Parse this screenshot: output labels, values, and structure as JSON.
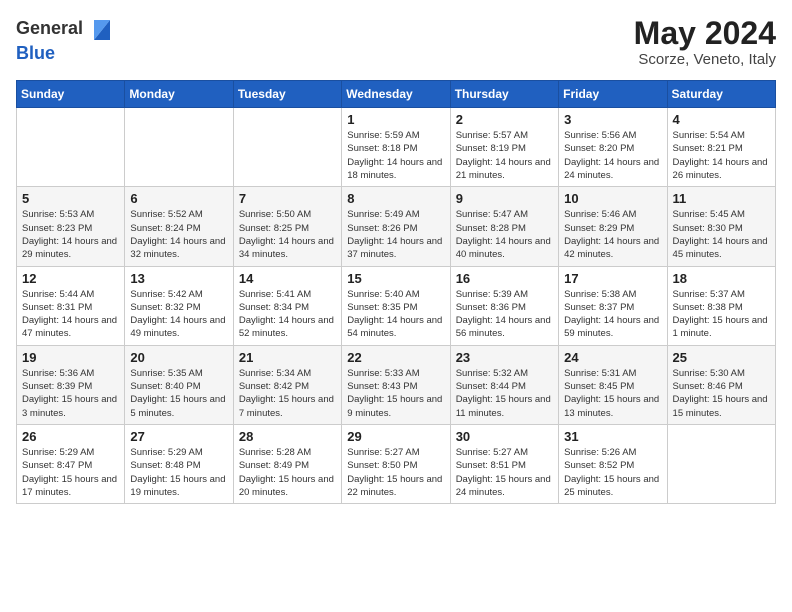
{
  "logo": {
    "general": "General",
    "blue": "Blue"
  },
  "title": "May 2024",
  "location": "Scorze, Veneto, Italy",
  "days_of_week": [
    "Sunday",
    "Monday",
    "Tuesday",
    "Wednesday",
    "Thursday",
    "Friday",
    "Saturday"
  ],
  "weeks": [
    [
      {
        "day": "",
        "sunrise": "",
        "sunset": "",
        "daylight": ""
      },
      {
        "day": "",
        "sunrise": "",
        "sunset": "",
        "daylight": ""
      },
      {
        "day": "",
        "sunrise": "",
        "sunset": "",
        "daylight": ""
      },
      {
        "day": "1",
        "sunrise": "Sunrise: 5:59 AM",
        "sunset": "Sunset: 8:18 PM",
        "daylight": "Daylight: 14 hours and 18 minutes."
      },
      {
        "day": "2",
        "sunrise": "Sunrise: 5:57 AM",
        "sunset": "Sunset: 8:19 PM",
        "daylight": "Daylight: 14 hours and 21 minutes."
      },
      {
        "day": "3",
        "sunrise": "Sunrise: 5:56 AM",
        "sunset": "Sunset: 8:20 PM",
        "daylight": "Daylight: 14 hours and 24 minutes."
      },
      {
        "day": "4",
        "sunrise": "Sunrise: 5:54 AM",
        "sunset": "Sunset: 8:21 PM",
        "daylight": "Daylight: 14 hours and 26 minutes."
      }
    ],
    [
      {
        "day": "5",
        "sunrise": "Sunrise: 5:53 AM",
        "sunset": "Sunset: 8:23 PM",
        "daylight": "Daylight: 14 hours and 29 minutes."
      },
      {
        "day": "6",
        "sunrise": "Sunrise: 5:52 AM",
        "sunset": "Sunset: 8:24 PM",
        "daylight": "Daylight: 14 hours and 32 minutes."
      },
      {
        "day": "7",
        "sunrise": "Sunrise: 5:50 AM",
        "sunset": "Sunset: 8:25 PM",
        "daylight": "Daylight: 14 hours and 34 minutes."
      },
      {
        "day": "8",
        "sunrise": "Sunrise: 5:49 AM",
        "sunset": "Sunset: 8:26 PM",
        "daylight": "Daylight: 14 hours and 37 minutes."
      },
      {
        "day": "9",
        "sunrise": "Sunrise: 5:47 AM",
        "sunset": "Sunset: 8:28 PM",
        "daylight": "Daylight: 14 hours and 40 minutes."
      },
      {
        "day": "10",
        "sunrise": "Sunrise: 5:46 AM",
        "sunset": "Sunset: 8:29 PM",
        "daylight": "Daylight: 14 hours and 42 minutes."
      },
      {
        "day": "11",
        "sunrise": "Sunrise: 5:45 AM",
        "sunset": "Sunset: 8:30 PM",
        "daylight": "Daylight: 14 hours and 45 minutes."
      }
    ],
    [
      {
        "day": "12",
        "sunrise": "Sunrise: 5:44 AM",
        "sunset": "Sunset: 8:31 PM",
        "daylight": "Daylight: 14 hours and 47 minutes."
      },
      {
        "day": "13",
        "sunrise": "Sunrise: 5:42 AM",
        "sunset": "Sunset: 8:32 PM",
        "daylight": "Daylight: 14 hours and 49 minutes."
      },
      {
        "day": "14",
        "sunrise": "Sunrise: 5:41 AM",
        "sunset": "Sunset: 8:34 PM",
        "daylight": "Daylight: 14 hours and 52 minutes."
      },
      {
        "day": "15",
        "sunrise": "Sunrise: 5:40 AM",
        "sunset": "Sunset: 8:35 PM",
        "daylight": "Daylight: 14 hours and 54 minutes."
      },
      {
        "day": "16",
        "sunrise": "Sunrise: 5:39 AM",
        "sunset": "Sunset: 8:36 PM",
        "daylight": "Daylight: 14 hours and 56 minutes."
      },
      {
        "day": "17",
        "sunrise": "Sunrise: 5:38 AM",
        "sunset": "Sunset: 8:37 PM",
        "daylight": "Daylight: 14 hours and 59 minutes."
      },
      {
        "day": "18",
        "sunrise": "Sunrise: 5:37 AM",
        "sunset": "Sunset: 8:38 PM",
        "daylight": "Daylight: 15 hours and 1 minute."
      }
    ],
    [
      {
        "day": "19",
        "sunrise": "Sunrise: 5:36 AM",
        "sunset": "Sunset: 8:39 PM",
        "daylight": "Daylight: 15 hours and 3 minutes."
      },
      {
        "day": "20",
        "sunrise": "Sunrise: 5:35 AM",
        "sunset": "Sunset: 8:40 PM",
        "daylight": "Daylight: 15 hours and 5 minutes."
      },
      {
        "day": "21",
        "sunrise": "Sunrise: 5:34 AM",
        "sunset": "Sunset: 8:42 PM",
        "daylight": "Daylight: 15 hours and 7 minutes."
      },
      {
        "day": "22",
        "sunrise": "Sunrise: 5:33 AM",
        "sunset": "Sunset: 8:43 PM",
        "daylight": "Daylight: 15 hours and 9 minutes."
      },
      {
        "day": "23",
        "sunrise": "Sunrise: 5:32 AM",
        "sunset": "Sunset: 8:44 PM",
        "daylight": "Daylight: 15 hours and 11 minutes."
      },
      {
        "day": "24",
        "sunrise": "Sunrise: 5:31 AM",
        "sunset": "Sunset: 8:45 PM",
        "daylight": "Daylight: 15 hours and 13 minutes."
      },
      {
        "day": "25",
        "sunrise": "Sunrise: 5:30 AM",
        "sunset": "Sunset: 8:46 PM",
        "daylight": "Daylight: 15 hours and 15 minutes."
      }
    ],
    [
      {
        "day": "26",
        "sunrise": "Sunrise: 5:29 AM",
        "sunset": "Sunset: 8:47 PM",
        "daylight": "Daylight: 15 hours and 17 minutes."
      },
      {
        "day": "27",
        "sunrise": "Sunrise: 5:29 AM",
        "sunset": "Sunset: 8:48 PM",
        "daylight": "Daylight: 15 hours and 19 minutes."
      },
      {
        "day": "28",
        "sunrise": "Sunrise: 5:28 AM",
        "sunset": "Sunset: 8:49 PM",
        "daylight": "Daylight: 15 hours and 20 minutes."
      },
      {
        "day": "29",
        "sunrise": "Sunrise: 5:27 AM",
        "sunset": "Sunset: 8:50 PM",
        "daylight": "Daylight: 15 hours and 22 minutes."
      },
      {
        "day": "30",
        "sunrise": "Sunrise: 5:27 AM",
        "sunset": "Sunset: 8:51 PM",
        "daylight": "Daylight: 15 hours and 24 minutes."
      },
      {
        "day": "31",
        "sunrise": "Sunrise: 5:26 AM",
        "sunset": "Sunset: 8:52 PM",
        "daylight": "Daylight: 15 hours and 25 minutes."
      },
      {
        "day": "",
        "sunrise": "",
        "sunset": "",
        "daylight": ""
      }
    ]
  ]
}
